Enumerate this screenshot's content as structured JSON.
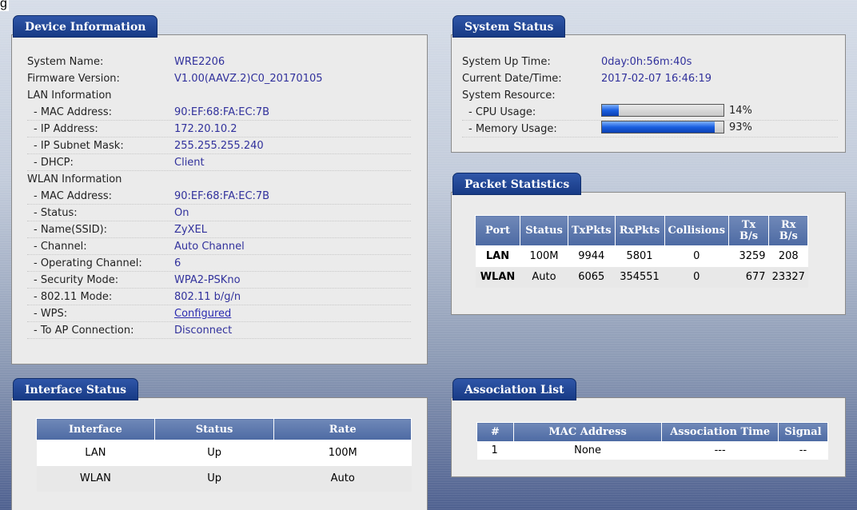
{
  "figure_label": "g",
  "device_info": {
    "title": "Device Information",
    "rows": [
      {
        "label": "System Name:",
        "value": "WRE2206"
      },
      {
        "label": "Firmware Version:",
        "value": "V1.00(AAVZ.2)C0_20170105"
      },
      {
        "label": "LAN Information",
        "value": ""
      },
      {
        "label": "- MAC Address:",
        "value": "90:EF:68:FA:EC:7B"
      },
      {
        "label": "- IP Address:",
        "value": "172.20.10.2"
      },
      {
        "label": "- IP Subnet Mask:",
        "value": "255.255.255.240"
      },
      {
        "label": "- DHCP:",
        "value": "Client"
      },
      {
        "label": "WLAN Information",
        "value": ""
      },
      {
        "label": "- MAC Address:",
        "value": "90:EF:68:FA:EC:7B"
      },
      {
        "label": "- Status:",
        "value": "On"
      },
      {
        "label": "- Name(SSID):",
        "value": "ZyXEL"
      },
      {
        "label": "- Channel:",
        "value": "Auto Channel"
      },
      {
        "label": "- Operating Channel:",
        "value": "6"
      },
      {
        "label": "- Security Mode:",
        "value": "WPA2-PSKno"
      },
      {
        "label": "- 802.11 Mode:",
        "value": "802.11 b/g/n"
      },
      {
        "label": "- WPS:",
        "value": "Configured"
      },
      {
        "label": "- To AP Connection:",
        "value": "Disconnect"
      }
    ]
  },
  "system_status": {
    "title": "System Status",
    "up_time_label": "System Up Time:",
    "up_time": "0day:0h:56m:40s",
    "datetime_label": "Current Date/Time:",
    "datetime": "2017-02-07 16:46:19",
    "resource_label": "System Resource:",
    "cpu_label": "- CPU Usage:",
    "cpu_pct": "14%",
    "cpu_fraction": 0.14,
    "mem_label": "- Memory Usage:",
    "mem_pct": "93%",
    "mem_fraction": 0.93
  },
  "packet_stats": {
    "title": "Packet Statistics",
    "headers": [
      "Port",
      "Status",
      "TxPkts",
      "RxPkts",
      "Collisions",
      "Tx\nB/s",
      "Rx\nB/s"
    ],
    "rows": [
      [
        "LAN",
        "100M",
        "9944",
        "5801",
        "0",
        "3259",
        "208"
      ],
      [
        "WLAN",
        "Auto",
        "6065",
        "354551",
        "0",
        "677",
        "23327"
      ]
    ]
  },
  "interface_status": {
    "title": "Interface Status",
    "headers": [
      "Interface",
      "Status",
      "Rate"
    ],
    "rows": [
      [
        "LAN",
        "Up",
        "100M"
      ],
      [
        "WLAN",
        "Up",
        "Auto"
      ]
    ]
  },
  "association_list": {
    "title": "Association List",
    "headers": [
      "#",
      "MAC Address",
      "Association Time",
      "Signal"
    ],
    "rows": [
      [
        "1",
        "None",
        "---",
        "--"
      ]
    ]
  },
  "colors": {
    "tab_blue": "#1f4696",
    "header_blue": "#5872a9",
    "value_text": "#31319c",
    "bar_fill": "#1a5fe0"
  }
}
